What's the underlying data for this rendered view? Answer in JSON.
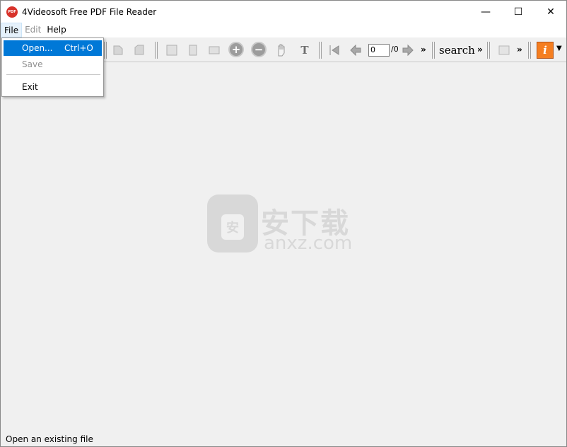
{
  "window": {
    "app_icon_text": "PDF",
    "title": "4Videosoft Free PDF File Reader",
    "min_glyph": "—",
    "max_glyph": "☐",
    "close_glyph": "✕"
  },
  "menubar": {
    "items": [
      {
        "label": "File"
      },
      {
        "label": "Edit"
      },
      {
        "label": "Help"
      }
    ]
  },
  "file_menu": {
    "open_label": "Open...",
    "open_shortcut": "Ctrl+O",
    "save_label": "Save",
    "exit_label": "Exit"
  },
  "toolbar": {
    "icons": [
      "rotate-left-icon",
      "rotate-right-icon",
      "actual-size-icon",
      "fit-page-icon",
      "fit-width-icon",
      "zoom-in-icon",
      "zoom-out-icon",
      "hand-icon",
      "text-select-icon",
      "first-page-icon",
      "prev-page-icon",
      "next-page-icon",
      "snapshot-icon",
      "info-icon"
    ],
    "zoom_in_glyph": "+",
    "zoom_out_glyph": "−",
    "text_glyph": "T",
    "page_value": "0",
    "page_total": "/0",
    "search_label": "search",
    "more_glyph": "»",
    "info_glyph": "i",
    "dropdown_glyph": "▼"
  },
  "watermark": {
    "shield_glyph": "安",
    "cn_text": "安下载",
    "en_text": "anxz.com"
  },
  "status": {
    "text": "Open an existing file"
  },
  "colors": {
    "selection": "#0078d7",
    "info_button": "#f57e20",
    "app_icon": "#d8332b"
  }
}
